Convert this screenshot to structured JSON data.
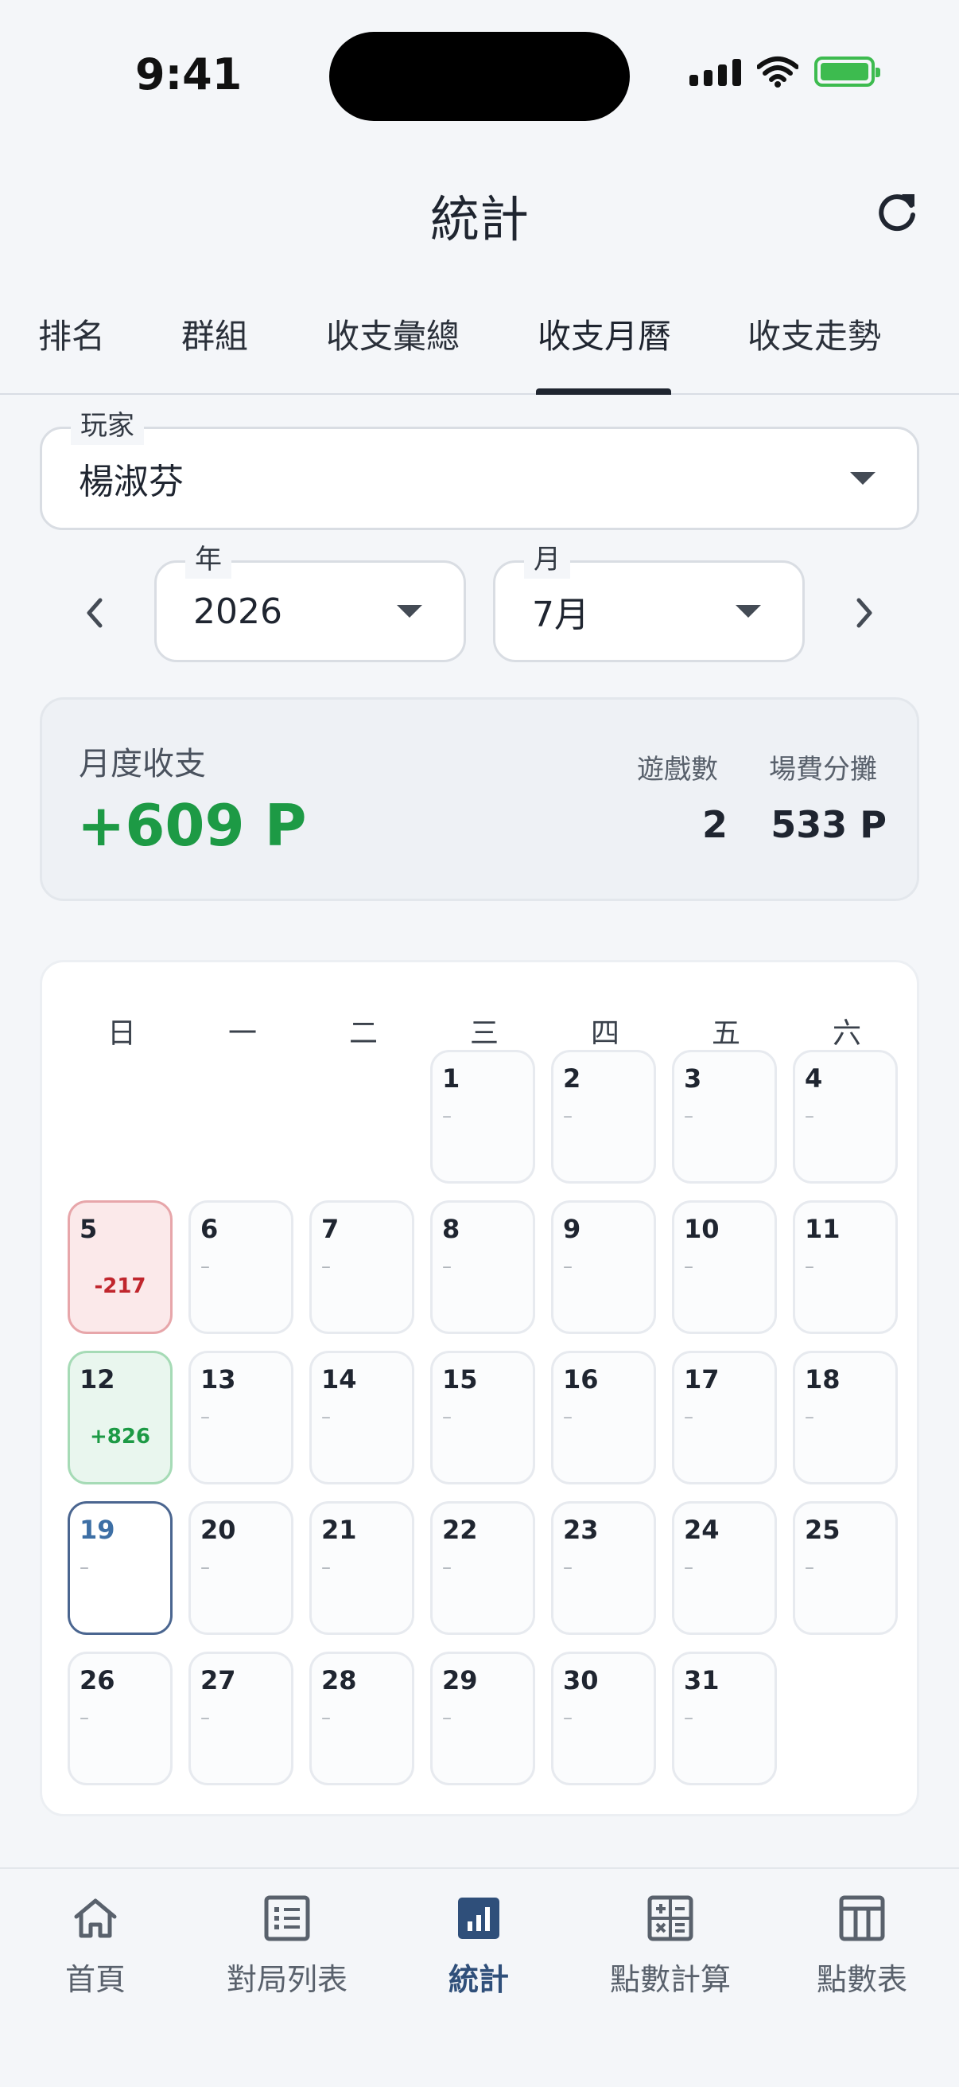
{
  "status_bar": {
    "time": "9:41"
  },
  "header": {
    "title": "統計"
  },
  "tabs": [
    {
      "label": "排名"
    },
    {
      "label": "群組"
    },
    {
      "label": "收支彙總"
    },
    {
      "label": "收支月曆",
      "active": true
    },
    {
      "label": "收支走勢"
    }
  ],
  "filters": {
    "player": {
      "label": "玩家",
      "value": "楊淑芬"
    },
    "year": {
      "label": "年",
      "value": "2026"
    },
    "month": {
      "label": "月",
      "value": "7月"
    }
  },
  "summary": {
    "label": "月度收支",
    "value": "+609 P",
    "games_label": "遊戲數",
    "games_value": "2",
    "fee_label": "場費分攤",
    "fee_value": "533 P"
  },
  "calendar": {
    "weekdays": [
      "日",
      "一",
      "二",
      "三",
      "四",
      "五",
      "六"
    ],
    "days": [
      {
        "num": "1",
        "val": "–"
      },
      {
        "num": "2",
        "val": "–"
      },
      {
        "num": "3",
        "val": "–"
      },
      {
        "num": "4",
        "val": "–"
      },
      {
        "num": "5",
        "val": "-217",
        "state": "neg"
      },
      {
        "num": "6",
        "val": "–"
      },
      {
        "num": "7",
        "val": "–"
      },
      {
        "num": "8",
        "val": "–"
      },
      {
        "num": "9",
        "val": "–"
      },
      {
        "num": "10",
        "val": "–"
      },
      {
        "num": "11",
        "val": "–"
      },
      {
        "num": "12",
        "val": "+826",
        "state": "pos"
      },
      {
        "num": "13",
        "val": "–"
      },
      {
        "num": "14",
        "val": "–"
      },
      {
        "num": "15",
        "val": "–"
      },
      {
        "num": "16",
        "val": "–"
      },
      {
        "num": "17",
        "val": "–"
      },
      {
        "num": "18",
        "val": "–"
      },
      {
        "num": "19",
        "val": "–",
        "state": "today"
      },
      {
        "num": "20",
        "val": "–"
      },
      {
        "num": "21",
        "val": "–"
      },
      {
        "num": "22",
        "val": "–"
      },
      {
        "num": "23",
        "val": "–"
      },
      {
        "num": "24",
        "val": "–"
      },
      {
        "num": "25",
        "val": "–"
      },
      {
        "num": "26",
        "val": "–"
      },
      {
        "num": "27",
        "val": "–"
      },
      {
        "num": "28",
        "val": "–"
      },
      {
        "num": "29",
        "val": "–"
      },
      {
        "num": "30",
        "val": "–"
      },
      {
        "num": "31",
        "val": "–"
      }
    ]
  },
  "bottom_nav": [
    {
      "label": "首頁",
      "icon": "home-icon"
    },
    {
      "label": "對局列表",
      "icon": "list-icon"
    },
    {
      "label": "統計",
      "icon": "bar-chart-icon",
      "active": true
    },
    {
      "label": "點數計算",
      "icon": "calculator-icon"
    },
    {
      "label": "點數表",
      "icon": "table-icon"
    }
  ],
  "colors": {
    "positive": "#1d9a45",
    "negative": "#c0262d",
    "accent": "#2f4f7a"
  }
}
